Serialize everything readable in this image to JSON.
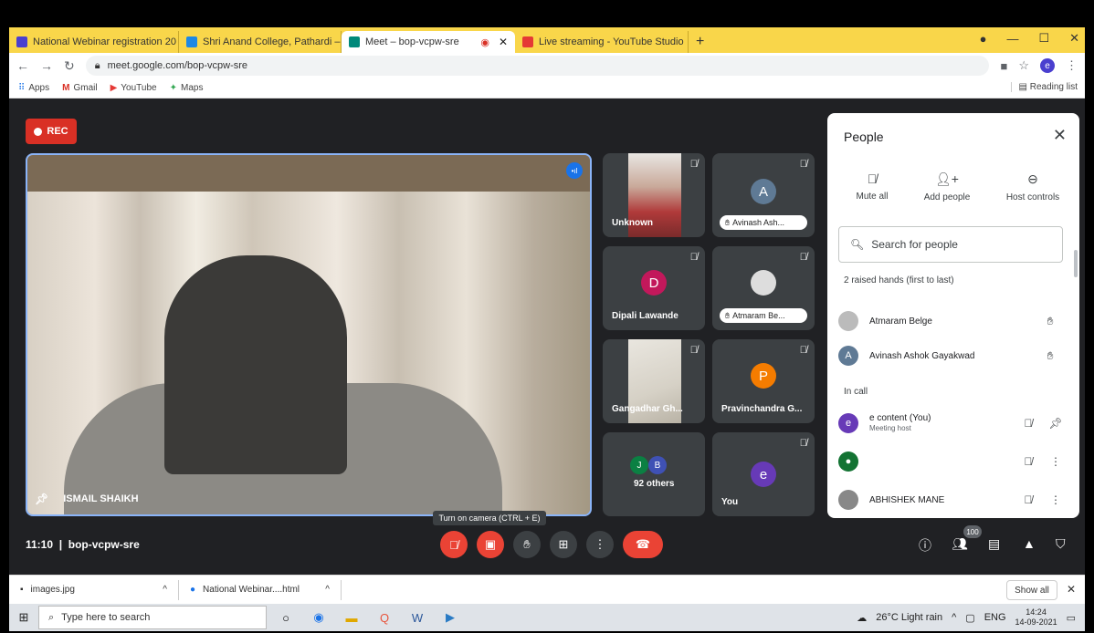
{
  "tabs": [
    {
      "title": "National Webinar registration 20",
      "color": "#4a3fcf"
    },
    {
      "title": "Shri Anand College, Pathardi – C",
      "color": "#1e88e5"
    },
    {
      "title": "Meet – bop-vcpw-sre",
      "color": "#00897b",
      "active": true
    },
    {
      "title": "Live streaming - YouTube Studio",
      "color": "#e53935"
    }
  ],
  "address": {
    "url": "meet.google.com/bop-vcpw-sre",
    "profile_initial": "e"
  },
  "bookmarks": [
    "Apps",
    "Gmail",
    "YouTube",
    "Maps"
  ],
  "reading_list": "Reading list",
  "meet": {
    "rec_label": "REC",
    "main_participant": "ISMAIL SHAIKH",
    "time": "11:10",
    "meeting_code": "bop-vcpw-sre",
    "tooltip": "Turn on camera (CTRL + E)",
    "people_count": "100"
  },
  "tiles": [
    {
      "name": "Unknown"
    },
    {
      "initial": "A",
      "chip": "Avinash Ash..."
    },
    {
      "initial": "D",
      "name": "Dipali Lawande"
    },
    {
      "chip": "Atmaram Be..."
    },
    {
      "name": "Gangadhar Gh..."
    },
    {
      "initial": "P",
      "name": "Pravinchandra G..."
    },
    {
      "avatars": [
        "J",
        "B"
      ],
      "name": "92 others"
    },
    {
      "initial": "e",
      "name": "You"
    }
  ],
  "people": {
    "title": "People",
    "actions": [
      "Mute all",
      "Add people",
      "Host controls"
    ],
    "search_placeholder": "Search for people",
    "raised_header": "2 raised hands (first to last)",
    "raised": [
      {
        "name": "Atmaram Belge"
      },
      {
        "name": "Avinash Ashok Gayakwad",
        "initial": "A"
      }
    ],
    "incall_header": "In call",
    "incall": [
      {
        "name": "e content (You)",
        "sub": "Meeting host",
        "initial": "e"
      },
      {
        "name": ""
      },
      {
        "name": "ABHISHEK MANE"
      }
    ]
  },
  "downloads": {
    "items": [
      "images.jpg",
      "National Webinar....html"
    ],
    "show_all": "Show all"
  },
  "taskbar": {
    "search_placeholder": "Type here to search",
    "weather": "26°C  Light rain",
    "lang": "ENG",
    "time": "14:24",
    "date": "14-09-2021"
  }
}
